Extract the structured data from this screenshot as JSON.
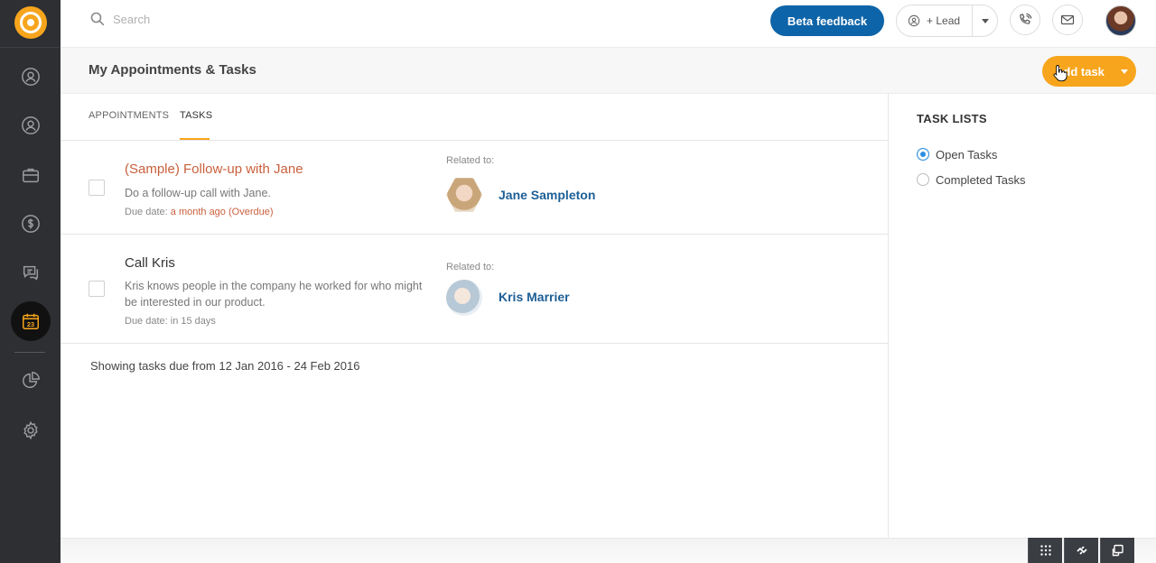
{
  "search": {
    "placeholder": "Search"
  },
  "topbar": {
    "beta_feedback": "Beta feedback",
    "lead_label": "+ Lead"
  },
  "header": {
    "title": "My Appointments & Tasks",
    "add_task": "Add task"
  },
  "tabs": [
    {
      "label": "APPOINTMENTS",
      "active": false
    },
    {
      "label": "TASKS",
      "active": true
    }
  ],
  "tasks": [
    {
      "title": "(Sample) Follow-up with Jane",
      "description": "Do a follow-up call with Jane.",
      "due_prefix": "Due date: ",
      "due_value": "a month ago (Overdue)",
      "overdue": true,
      "related_label": "Related to:",
      "related_name": "Jane Sampleton"
    },
    {
      "title": "Call Kris",
      "description": "Kris knows people in the company he worked for who might be interested in our product.",
      "due_prefix": "Due date: ",
      "due_value": "in 15 days",
      "overdue": false,
      "related_label": "Related to:",
      "related_name": "Kris Marrier"
    }
  ],
  "showing_text": "Showing tasks due from 12 Jan 2016 - 24 Feb 2016",
  "task_lists": {
    "title": "TASK LISTS",
    "options": [
      {
        "label": "Open Tasks",
        "checked": true
      },
      {
        "label": "Completed Tasks",
        "checked": false
      }
    ]
  },
  "sidebar": {
    "items": [
      {
        "icon": "contacts-icon"
      },
      {
        "icon": "person-icon"
      },
      {
        "icon": "briefcase-icon"
      },
      {
        "icon": "dollar-icon"
      },
      {
        "icon": "chat-icon"
      },
      {
        "icon": "calendar-icon",
        "active": true,
        "day": "23"
      },
      {
        "icon": "reports-icon"
      },
      {
        "icon": "settings-icon"
      }
    ]
  },
  "colors": {
    "sidebar_bg": "#2d2f33",
    "accent_orange": "#f7a51c",
    "primary_blue": "#0e64a8",
    "overdue": "#c9603c",
    "link_blue": "#1d5f96"
  }
}
